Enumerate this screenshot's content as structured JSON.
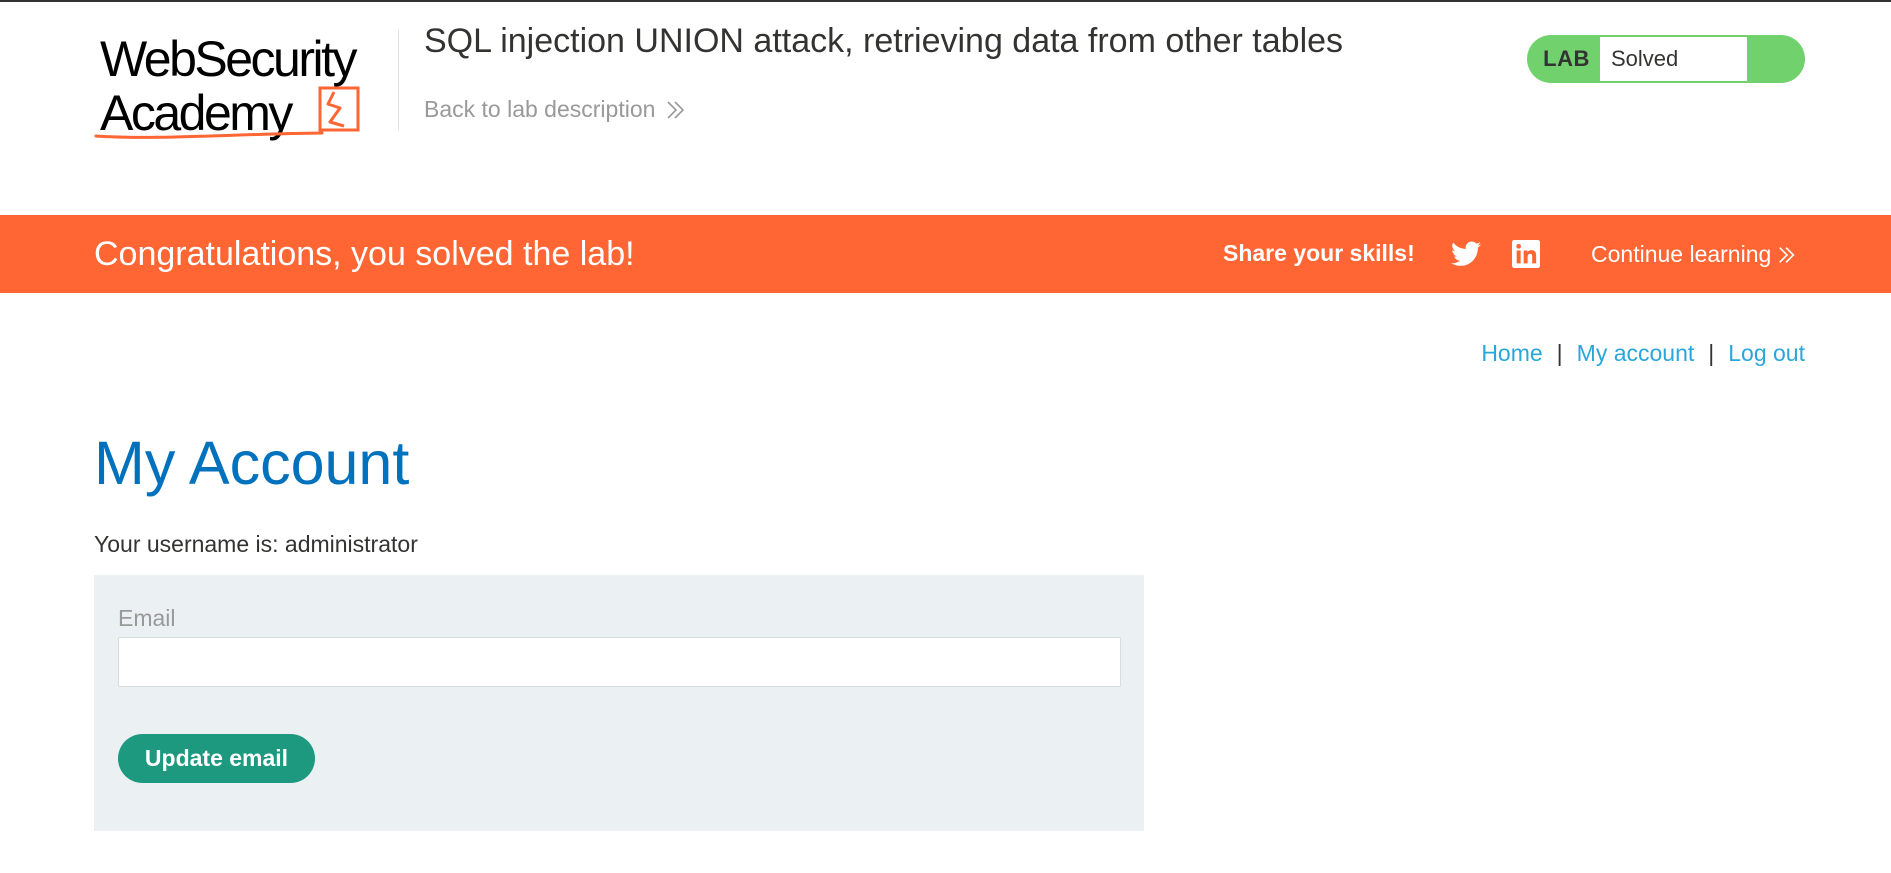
{
  "header": {
    "logo_text": "WebSecurity Academy",
    "lab_title": "SQL injection UNION attack, retrieving data from other tables",
    "back_link": "Back to lab description",
    "lab_badge": {
      "label": "LAB",
      "status": "Solved"
    }
  },
  "banner": {
    "message": "Congratulations, you solved the lab!",
    "share_label": "Share your skills!",
    "social_icons": [
      "twitter-icon",
      "linkedin-icon"
    ],
    "continue_label": "Continue learning"
  },
  "nav": {
    "home": "Home",
    "separator": "|",
    "my_account": "My account",
    "log_out": "Log out"
  },
  "main": {
    "title": "My Account",
    "username_line": "Your username is: administrator",
    "email_form": {
      "email_label": "Email",
      "email_value": "",
      "submit_label": "Update email"
    }
  },
  "colors": {
    "brand_orange": "#ff6633",
    "solved_green": "#70d16d",
    "title_blue": "#0071bc",
    "link_blue": "#29a6db",
    "button_teal": "#1c997f",
    "form_bg": "#ebf0f2"
  }
}
